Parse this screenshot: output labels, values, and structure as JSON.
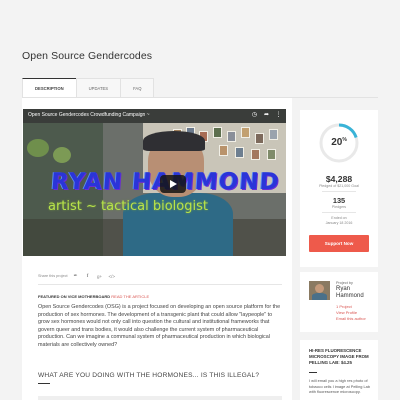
{
  "page": {
    "title": "Open Source Gendercodes"
  },
  "tabs": [
    {
      "label": "DESCRIPTION",
      "active": true
    },
    {
      "label": "UPDATES",
      "active": false
    },
    {
      "label": "FAQ",
      "active": false
    }
  ],
  "video": {
    "title": "Open Source Gendercodes Crowdfunding Campaign ~",
    "overlay_name": "RYAN HAMMOND",
    "overlay_subtitle": "artist ~ tactical biologist",
    "icons": [
      "clock-icon",
      "share-icon",
      "more-icon",
      "play-icon"
    ]
  },
  "share": {
    "label": "Share this project",
    "icons": [
      "twitter-icon",
      "facebook-icon",
      "google-plus-icon",
      "embed-icon"
    ]
  },
  "featured": {
    "label": "FEATURED ON VICE MOTHERBOARD",
    "link_text": "READ THE ARTICLE"
  },
  "description": "Open Source Gendercodes (OSG) is a project focused on developing an open source platform for the production of sex hormones. The development of a transgenic plant that could allow \"laypeople\" to grow sex hormones would not only call into question the cultural and institutional frameworks that govern queer and trans bodies, it would also challenge the current system of pharmaceutical production. Can we imagine a communal system of pharmaceutical production in which biological materials are collectively owned?",
  "subheading": "WHAT ARE YOU DOING WITH THE HORMONES... IS THIS ILLEGAL?",
  "funding": {
    "percent": "20",
    "percent_sign": "%",
    "percent_value": 0.2,
    "pledged": "$4,288",
    "goal_text": "Pledged of $21,000 Goal",
    "pledgers": "135",
    "pledgers_label": "Pledgers",
    "ended_label": "Ended on",
    "ended_date": "January 18 2016",
    "support_label": "Support Now",
    "accent_color": "#ee5a4b",
    "ring_color": "#39b3d7"
  },
  "creator": {
    "project_by": "Project by",
    "name_line1": "Ryan",
    "name_line2": "Hammond",
    "project_count": "1 Project",
    "view_profile": "View Profile",
    "email": "Email this author"
  },
  "reward": {
    "title": "HI-RES FLUORESCENCE MICROSCOPY IMAGE FROM PELLING LAB: $4.25",
    "description": "I will email you a high res photo of tobacco cells I image at Pelling Lab with fluorescence microscopy."
  }
}
